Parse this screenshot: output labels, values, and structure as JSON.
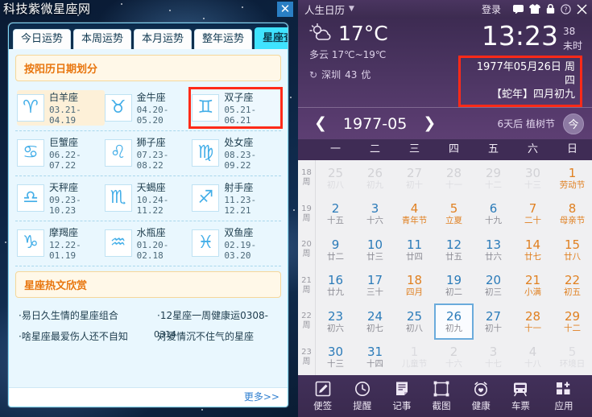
{
  "left_panel": {
    "site_title": "科技紫微星座网",
    "close_icon": "close-icon",
    "tabs": [
      {
        "label": "今日运势",
        "active": false
      },
      {
        "label": "本周运势",
        "active": false
      },
      {
        "label": "本月运势",
        "active": false
      },
      {
        "label": "整年运势",
        "active": false
      },
      {
        "label": "星座查询",
        "active": true
      }
    ],
    "section_head": "按阳历日期划分",
    "zodiacs": [
      {
        "name": "白羊座",
        "date": "03.21-04.19",
        "glyph": "♈",
        "highlight": "soft"
      },
      {
        "name": "金牛座",
        "date": "04.20-05.20",
        "glyph": "♉",
        "highlight": "none"
      },
      {
        "name": "双子座",
        "date": "05.21-06.21",
        "glyph": "♊",
        "highlight": "box"
      },
      {
        "name": "巨蟹座",
        "date": "06.22-07.22",
        "glyph": "♋",
        "highlight": "none"
      },
      {
        "name": "狮子座",
        "date": "07.23-08.22",
        "glyph": "♌",
        "highlight": "none"
      },
      {
        "name": "处女座",
        "date": "08.23-09.22",
        "glyph": "♍",
        "highlight": "none"
      },
      {
        "name": "天秤座",
        "date": "09.23-10.23",
        "glyph": "♎",
        "highlight": "none"
      },
      {
        "name": "天蝎座",
        "date": "10.24-11.22",
        "glyph": "♏",
        "highlight": "none"
      },
      {
        "name": "射手座",
        "date": "11.23-12.21",
        "glyph": "♐",
        "highlight": "none"
      },
      {
        "name": "摩羯座",
        "date": "12.22-01.19",
        "glyph": "♑",
        "highlight": "none"
      },
      {
        "name": "水瓶座",
        "date": "01.20-02.18",
        "glyph": "♒",
        "highlight": "none"
      },
      {
        "name": "双鱼座",
        "date": "02.19-03.20",
        "glyph": "♓",
        "highlight": "none"
      }
    ],
    "hot_head": "星座热文欣赏",
    "hot_rows": [
      {
        "a": "·易日久生情的星座组合",
        "b": "·12星座一周健康运0308-",
        "overlay": ""
      },
      {
        "a": "·啥星座最爱伤人还不自知",
        "b": "对爱情沉不住气的星座",
        "overlay": "0314"
      }
    ],
    "more_label": "更多>>"
  },
  "right_panel": {
    "titlebar": {
      "name": "人生日历",
      "caret_icon": "chevron-down-icon",
      "login_label": "登录",
      "icons": [
        "message-icon",
        "shirt-icon",
        "lock-icon",
        "help-icon",
        "close-icon"
      ]
    },
    "weather": {
      "icon": "sun-cloud-icon",
      "temp": "17°C",
      "condition": "多云",
      "range": "17℃~19℃",
      "refresh_icon": "refresh-icon",
      "city": "深圳",
      "aqi": "43",
      "aqi_label": "优"
    },
    "clock": {
      "time": "13:23",
      "seconds": "38",
      "shichen": "未时",
      "date_line1": "1977年05月26日 周四",
      "date_line2": "【蛇年】四月初九"
    },
    "nav": {
      "prev_icon": "chevron-left-icon",
      "month": "1977-05",
      "next_icon": "chevron-right-icon",
      "festival_note": "6天后 植树节",
      "today_label": "今"
    },
    "weekdays": [
      "一",
      "二",
      "三",
      "四",
      "五",
      "六",
      "日"
    ],
    "week_numbers": [
      {
        "n": "18",
        "z": "周"
      },
      {
        "n": "19",
        "z": "周"
      },
      {
        "n": "20",
        "z": "周"
      },
      {
        "n": "21",
        "z": "周"
      },
      {
        "n": "22",
        "z": "周"
      },
      {
        "n": "23",
        "z": "周"
      }
    ],
    "days": [
      {
        "num": "25",
        "lun": "初八",
        "out": true,
        "fest": false,
        "sel": false
      },
      {
        "num": "26",
        "lun": "初九",
        "out": true,
        "fest": false,
        "sel": false
      },
      {
        "num": "27",
        "lun": "初十",
        "out": true,
        "fest": false,
        "sel": false
      },
      {
        "num": "28",
        "lun": "十一",
        "out": true,
        "fest": false,
        "sel": false
      },
      {
        "num": "29",
        "lun": "十二",
        "out": true,
        "fest": false,
        "sel": false
      },
      {
        "num": "30",
        "lun": "十三",
        "out": true,
        "fest": false,
        "sel": false
      },
      {
        "num": "1",
        "lun": "劳动节",
        "out": false,
        "fest": true,
        "sel": false
      },
      {
        "num": "2",
        "lun": "十五",
        "out": false,
        "fest": false,
        "sel": false
      },
      {
        "num": "3",
        "lun": "十六",
        "out": false,
        "fest": false,
        "sel": false
      },
      {
        "num": "4",
        "lun": "青年节",
        "out": false,
        "fest": true,
        "sel": false
      },
      {
        "num": "5",
        "lun": "立夏",
        "out": false,
        "fest": true,
        "sel": false
      },
      {
        "num": "6",
        "lun": "十九",
        "out": false,
        "fest": false,
        "sel": false
      },
      {
        "num": "7",
        "lun": "二十",
        "out": false,
        "fest": true,
        "sel": false
      },
      {
        "num": "8",
        "lun": "母亲节",
        "out": false,
        "fest": true,
        "sel": false
      },
      {
        "num": "9",
        "lun": "廿二",
        "out": false,
        "fest": false,
        "sel": false
      },
      {
        "num": "10",
        "lun": "廿三",
        "out": false,
        "fest": false,
        "sel": false
      },
      {
        "num": "11",
        "lun": "廿四",
        "out": false,
        "fest": false,
        "sel": false
      },
      {
        "num": "12",
        "lun": "廿五",
        "out": false,
        "fest": false,
        "sel": false
      },
      {
        "num": "13",
        "lun": "廿六",
        "out": false,
        "fest": false,
        "sel": false
      },
      {
        "num": "14",
        "lun": "廿七",
        "out": false,
        "fest": true,
        "sel": false
      },
      {
        "num": "15",
        "lun": "廿八",
        "out": false,
        "fest": true,
        "sel": false
      },
      {
        "num": "16",
        "lun": "廿九",
        "out": false,
        "fest": false,
        "sel": false
      },
      {
        "num": "17",
        "lun": "三十",
        "out": false,
        "fest": false,
        "sel": false
      },
      {
        "num": "18",
        "lun": "四月",
        "out": false,
        "fest": true,
        "sel": false
      },
      {
        "num": "19",
        "lun": "初二",
        "out": false,
        "fest": false,
        "sel": false
      },
      {
        "num": "20",
        "lun": "初三",
        "out": false,
        "fest": false,
        "sel": false
      },
      {
        "num": "21",
        "lun": "小满",
        "out": false,
        "fest": true,
        "sel": false
      },
      {
        "num": "22",
        "lun": "初五",
        "out": false,
        "fest": true,
        "sel": false
      },
      {
        "num": "23",
        "lun": "初六",
        "out": false,
        "fest": false,
        "sel": false
      },
      {
        "num": "24",
        "lun": "初七",
        "out": false,
        "fest": false,
        "sel": false
      },
      {
        "num": "25",
        "lun": "初八",
        "out": false,
        "fest": false,
        "sel": false
      },
      {
        "num": "26",
        "lun": "初九",
        "out": false,
        "fest": false,
        "sel": true
      },
      {
        "num": "27",
        "lun": "初十",
        "out": false,
        "fest": false,
        "sel": false
      },
      {
        "num": "28",
        "lun": "十一",
        "out": false,
        "fest": true,
        "sel": false
      },
      {
        "num": "29",
        "lun": "十二",
        "out": false,
        "fest": true,
        "sel": false
      },
      {
        "num": "30",
        "lun": "十三",
        "out": false,
        "fest": false,
        "sel": false
      },
      {
        "num": "31",
        "lun": "十四",
        "out": false,
        "fest": false,
        "sel": false
      },
      {
        "num": "1",
        "lun": "儿童节",
        "out": true,
        "fest": true,
        "sel": false
      },
      {
        "num": "2",
        "lun": "十六",
        "out": true,
        "fest": false,
        "sel": false
      },
      {
        "num": "3",
        "lun": "十七",
        "out": true,
        "fest": false,
        "sel": false
      },
      {
        "num": "4",
        "lun": "十八",
        "out": true,
        "fest": false,
        "sel": false
      },
      {
        "num": "5",
        "lun": "环境日",
        "out": true,
        "fest": true,
        "sel": false
      }
    ],
    "toolbar": [
      {
        "label": "便签",
        "icon": "note-pencil-icon"
      },
      {
        "label": "提醒",
        "icon": "clock-icon"
      },
      {
        "label": "记事",
        "icon": "document-icon"
      },
      {
        "label": "截图",
        "icon": "crop-icon"
      },
      {
        "label": "健康",
        "icon": "alarm-heart-icon"
      },
      {
        "label": "车票",
        "icon": "train-icon"
      },
      {
        "label": "应用",
        "icon": "apps-plus-icon"
      }
    ]
  },
  "colors": {
    "accent_cyan": "#3fe3ff",
    "highlight_red": "#ff2a18",
    "calendar_blue": "#2b7bb9",
    "festival_orange": "#e08021",
    "panel_purple": "#3a2a4e"
  }
}
